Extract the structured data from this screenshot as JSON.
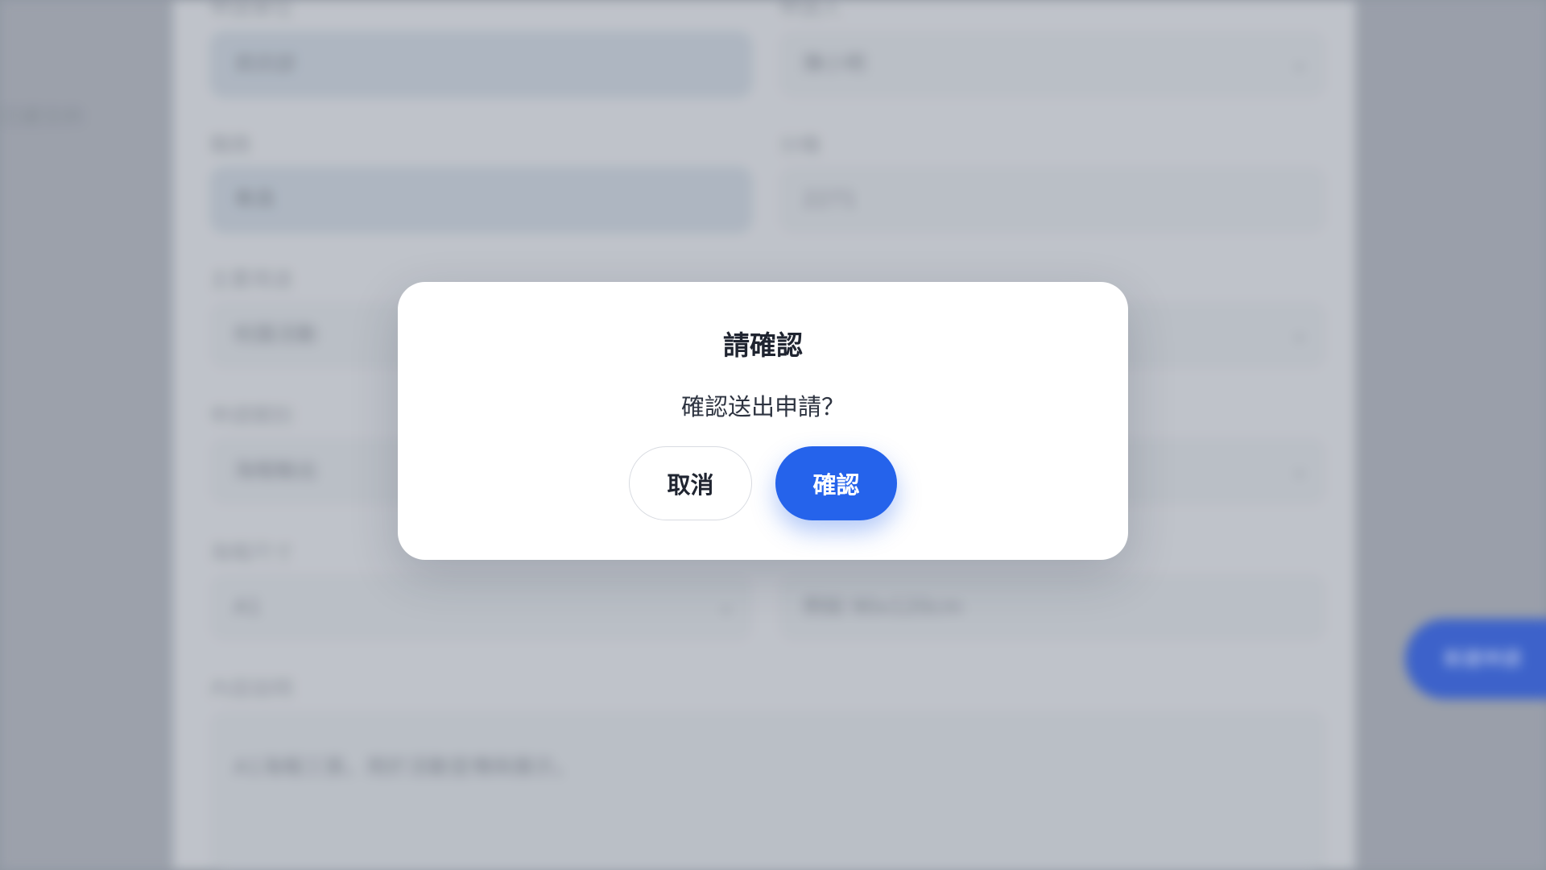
{
  "background": {
    "nav_text": "已提交的",
    "float_button": "新建申請",
    "fields": [
      {
        "label": "申請單位",
        "value": "資訊部"
      },
      {
        "label": "申請人",
        "value": "陳小明"
      },
      {
        "label": "職務",
        "value": "專員"
      },
      {
        "label": "分機",
        "value": "2271"
      },
      {
        "label": "主要用途",
        "value": "校園活動"
      },
      {
        "label": "申請類別",
        "value": "海報輸出"
      },
      {
        "label": "海報尺寸",
        "value": "A1"
      },
      {
        "label": "",
        "value": "例如 90x120cm"
      },
      {
        "label": "內容說明",
        "value": "A1海報三張，用於活動宣傳與展示。"
      }
    ]
  },
  "dialog": {
    "title": "請確認",
    "message": "確認送出申請？",
    "cancel_label": "取消",
    "confirm_label": "確認"
  },
  "colors": {
    "accent": "#2563eb",
    "modal_bg": "#ffffff",
    "overlay_tint": "#9aa0ab"
  }
}
